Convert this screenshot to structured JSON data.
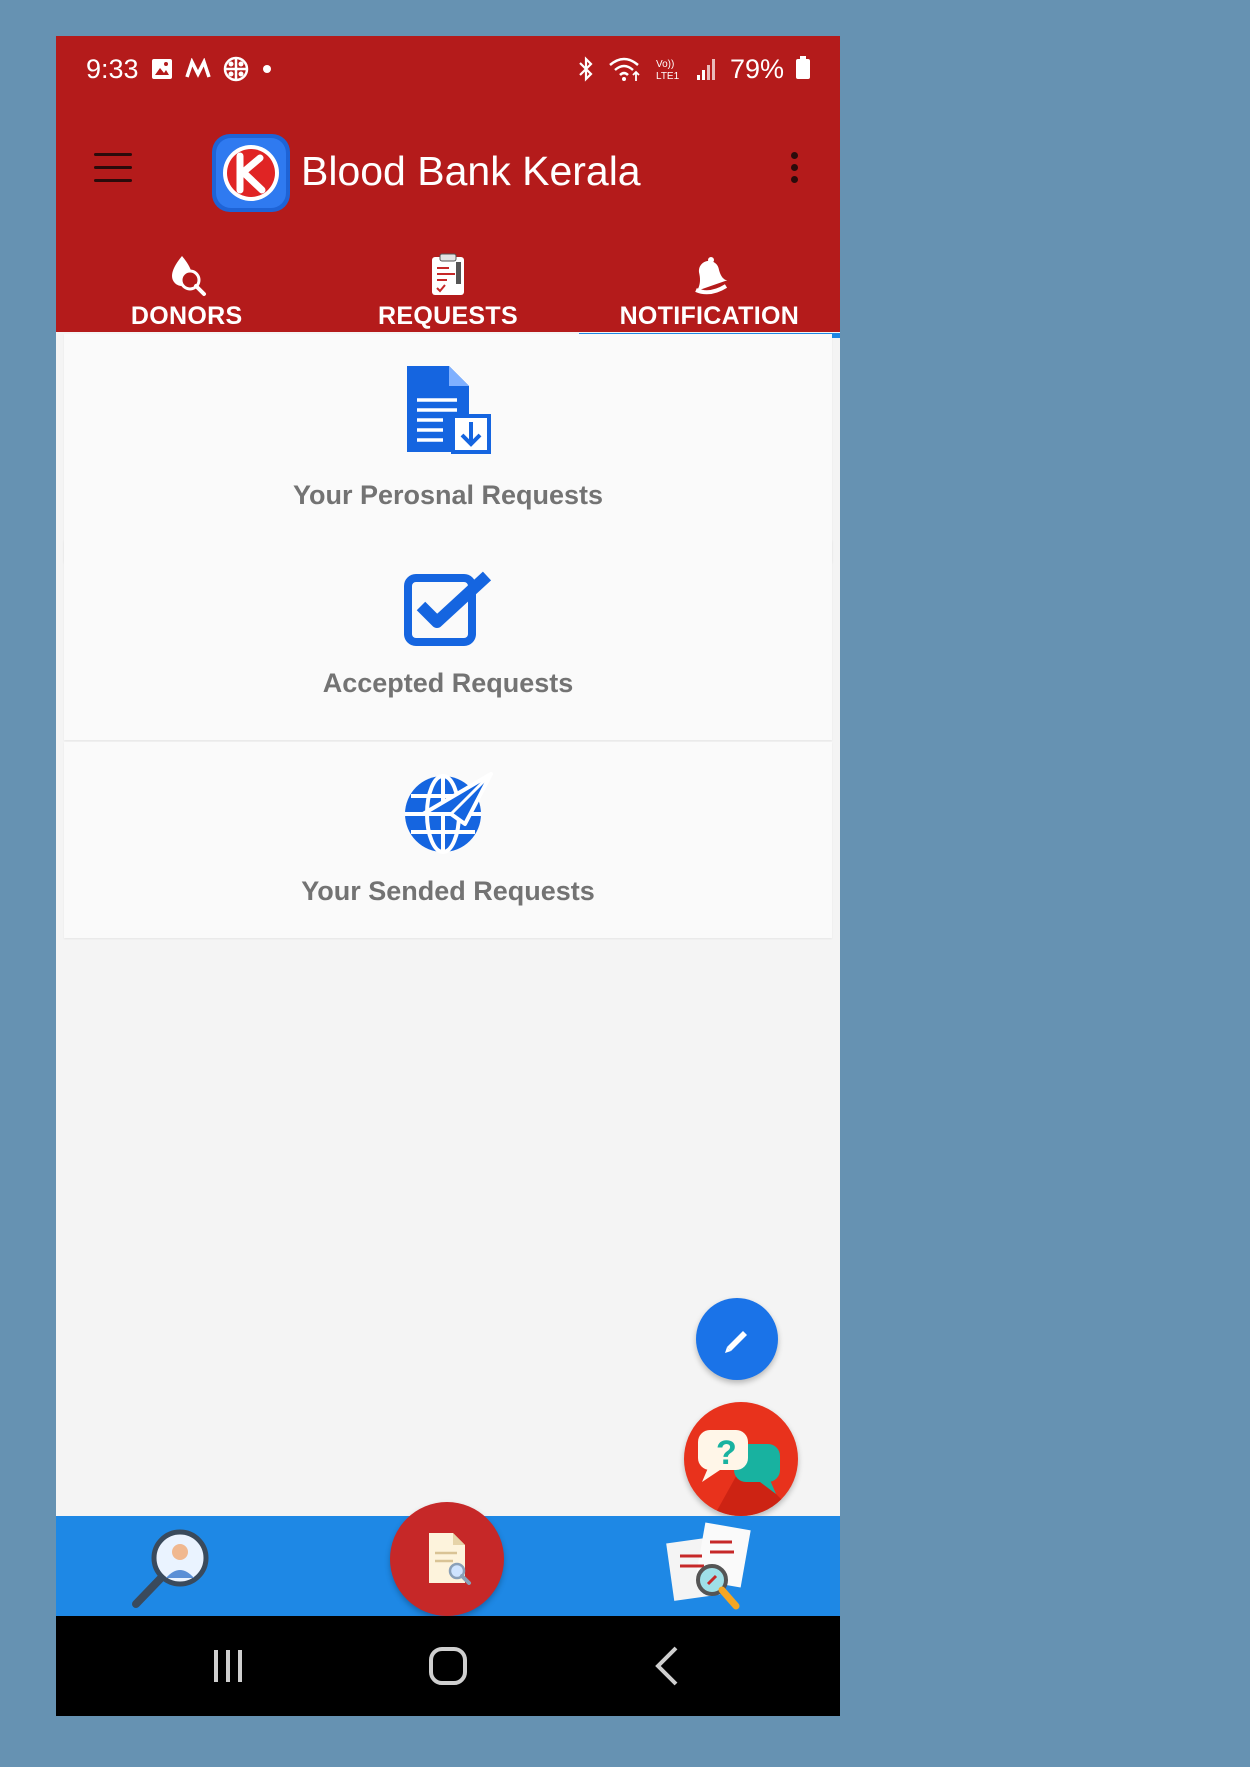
{
  "status_bar": {
    "time": "9:33",
    "battery": "79%",
    "left_icons": [
      "gallery-icon",
      "m-app-icon",
      "app-icon",
      "dot-icon"
    ],
    "right_icons": [
      "bluetooth-icon",
      "wifi-icon",
      "volte-icon",
      "signal-icon",
      "battery-icon"
    ]
  },
  "app_bar": {
    "title": "Blood Bank Kerala",
    "brand_color": "#b41b1b"
  },
  "tabs": [
    {
      "label": "DONORS",
      "icon": "donor-search-icon",
      "active": false
    },
    {
      "label": "REQUESTS",
      "icon": "clipboard-icon",
      "active": false
    },
    {
      "label": "NOTIFICATION",
      "icon": "bell-icon",
      "active": true
    }
  ],
  "cards": [
    {
      "label": "Your Perosnal Requests",
      "icon": "document-download-icon"
    },
    {
      "label": "Accepted Requests",
      "icon": "checkbox-icon"
    },
    {
      "label": "Your Sended Requests",
      "icon": "globe-send-icon"
    }
  ],
  "fabs": {
    "edit": {
      "icon": "pencil-icon",
      "color": "#1a73e8"
    },
    "help": {
      "icon": "help-chat-icon",
      "color": "#e8321c"
    }
  },
  "bottom_nav": {
    "items": [
      "search-donor-icon",
      "request-doc-search-icon",
      "reports-search-icon"
    ],
    "color": "#1e88e5",
    "center_color": "#c62828"
  },
  "system_nav": [
    "recents-icon",
    "home-icon",
    "back-icon"
  ]
}
